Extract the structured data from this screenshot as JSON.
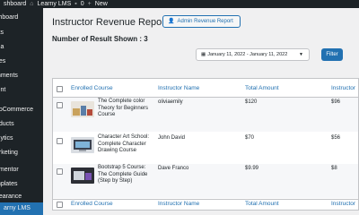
{
  "admin_bar": {
    "dashboard_label": "shboard",
    "site_name": "Learny LMS",
    "comment_count": "0",
    "new_label": "New"
  },
  "sidebar": {
    "items": [
      {
        "label": "shboard"
      },
      {
        "label": "sts"
      },
      {
        "label": "dia"
      },
      {
        "label": "ges"
      },
      {
        "label": "mments"
      },
      {
        "label": "ient"
      },
      {
        "label": "ooCommerce"
      },
      {
        "label": "oducts"
      },
      {
        "label": "alytics"
      },
      {
        "label": "arketing"
      },
      {
        "label": "ementor"
      },
      {
        "label": "mplates"
      },
      {
        "label": "pearance"
      },
      {
        "label": "arny LMS"
      }
    ]
  },
  "header": {
    "title": "Instructor Revenue Report",
    "admin_button_label": "Admin Revenue Report"
  },
  "results": {
    "text": "Number of Result Shown : 3"
  },
  "filters": {
    "date_range": "January 11, 2022 - January 11, 2022",
    "filter_label": "Filter"
  },
  "table": {
    "columns": [
      "Enrolled Course",
      "Instructor Name",
      "Total Amount",
      "Instructor"
    ],
    "rows": [
      {
        "course": "The Complete color Theory for Beginners Course",
        "instructor": "oliviaemily",
        "total": "$120",
        "share": "$96"
      },
      {
        "course": "Character Art School: Complete Character Drawing Course",
        "instructor": "John David",
        "total": "$70",
        "share": "$56"
      },
      {
        "course": "Bootstrap 5 Course: The Complete Guide (Step by Step)",
        "instructor": "Dave Franco",
        "total": "$9.99",
        "share": "$8"
      }
    ]
  },
  "colors": {
    "accent": "#2271b1",
    "sidebar_bg": "#1d2327",
    "page_bg": "#f0f0f1"
  },
  "icons": [
    "wordpress-icon",
    "home-icon",
    "comment-icon",
    "plus-icon",
    "user-icon",
    "calendar-icon",
    "chevron-down-icon",
    "checkbox-icon",
    "course-thumbnail"
  ]
}
